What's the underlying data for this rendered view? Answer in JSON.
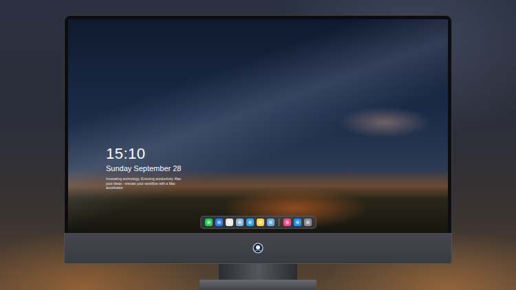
{
  "lock_screen": {
    "time": "15:10",
    "date": "Sunday September 28",
    "tagline": "Innovating technology. Ensuring productivity. Mac your ideas - elevate your workflow with a Mac accelerator"
  },
  "dock": {
    "apps": [
      {
        "color": "#34c759"
      },
      {
        "color": "#2f7ff0"
      },
      {
        "color": "#e8e8ea"
      },
      {
        "color": "#8fb6d8"
      },
      {
        "color": "#35a7d8"
      },
      {
        "color": "#f5d54a"
      },
      {
        "color": "#6fa8dc"
      }
    ],
    "recent": [
      {
        "color": "#f0508a"
      },
      {
        "color": "#1e90ff"
      },
      {
        "color": "#8e8e93"
      }
    ]
  }
}
